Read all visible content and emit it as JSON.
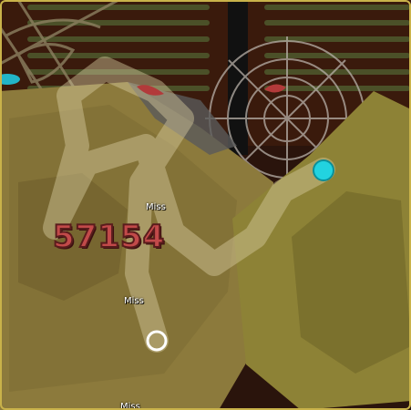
{
  "hud": {
    "score": "57154"
  },
  "judgements": [
    {
      "text": "Miss"
    },
    {
      "text": "Miss"
    },
    {
      "text": "Miss"
    }
  ],
  "colors": {
    "cursor": "#22d3e0",
    "slider_track": "#d9cfa0",
    "score_fill": "#c24a4a",
    "rock": "#8a7a3a"
  }
}
